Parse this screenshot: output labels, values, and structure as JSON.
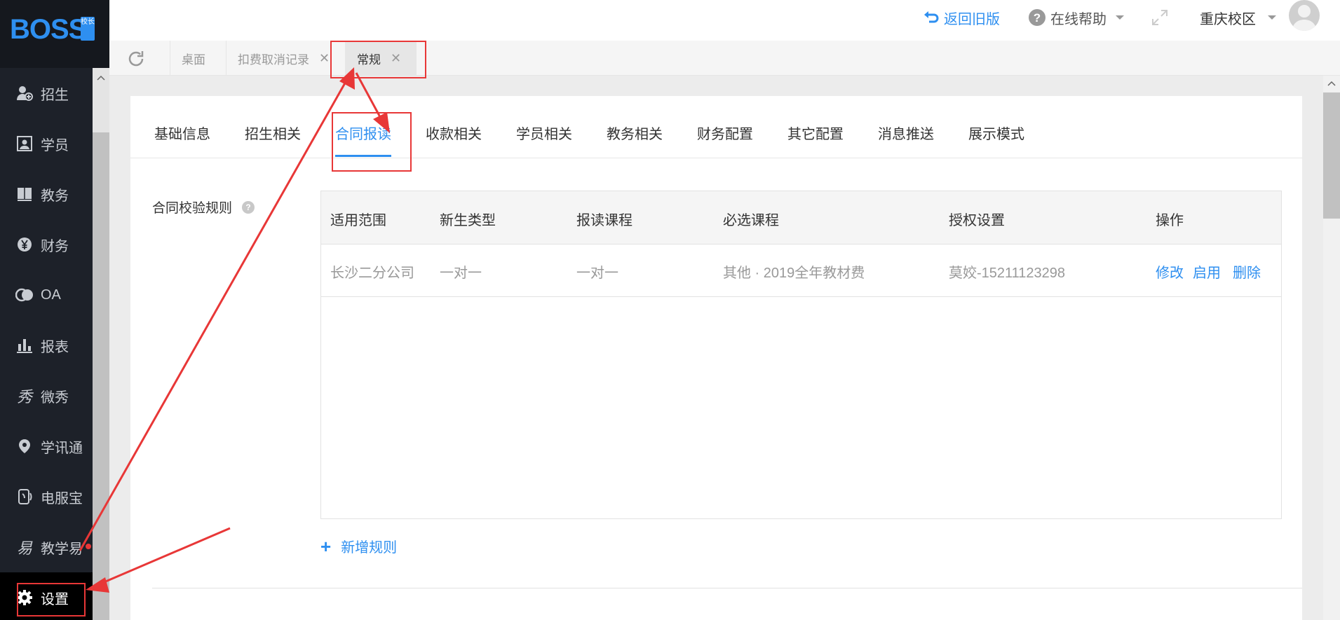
{
  "logo": {
    "text": "BOSS",
    "badge": "校长"
  },
  "sidebar": {
    "items": [
      {
        "label": "招生",
        "icon": "user-add-icon"
      },
      {
        "label": "学员",
        "icon": "id-card-icon"
      },
      {
        "label": "教务",
        "icon": "book-icon"
      },
      {
        "label": "财务",
        "icon": "yen-icon"
      },
      {
        "label": "OA",
        "icon": "oa-icon"
      },
      {
        "label": "报表",
        "icon": "bar-chart-icon"
      },
      {
        "label": "微秀",
        "icon": "xiu-icon"
      },
      {
        "label": "学讯通",
        "icon": "location-icon"
      },
      {
        "label": "电服宝",
        "icon": "phone-icon"
      },
      {
        "label": "教学易",
        "icon": "teach-icon"
      },
      {
        "label": "设置",
        "icon": "gear-icon"
      }
    ]
  },
  "header": {
    "back_old": "返回旧版",
    "help": "在线帮助",
    "campus": "重庆校区"
  },
  "page_tabs": [
    {
      "label": "桌面"
    },
    {
      "label": "扣费取消记录"
    },
    {
      "label": "常规"
    }
  ],
  "settings_tabs": [
    "基础信息",
    "招生相关",
    "合同报读",
    "收款相关",
    "学员相关",
    "教务相关",
    "财务配置",
    "其它配置",
    "消息推送",
    "展示模式"
  ],
  "contract": {
    "label": "合同校验规则",
    "columns": [
      "适用范围",
      "新生类型",
      "报读课程",
      "必选课程",
      "授权设置",
      "操作"
    ],
    "rows": [
      {
        "scope": "长沙二分公司",
        "student_type": "一对一",
        "course": "一对一",
        "required": "其他 · 2019全年教材费",
        "auth": "莫姣-15211123298",
        "ops": [
          "修改",
          "启用",
          "删除"
        ]
      }
    ],
    "add_rule": "新增规则"
  },
  "colors": {
    "accent": "#2e8ff0",
    "sidebar_bg": "#1d2129",
    "annotation": "#e83737"
  }
}
